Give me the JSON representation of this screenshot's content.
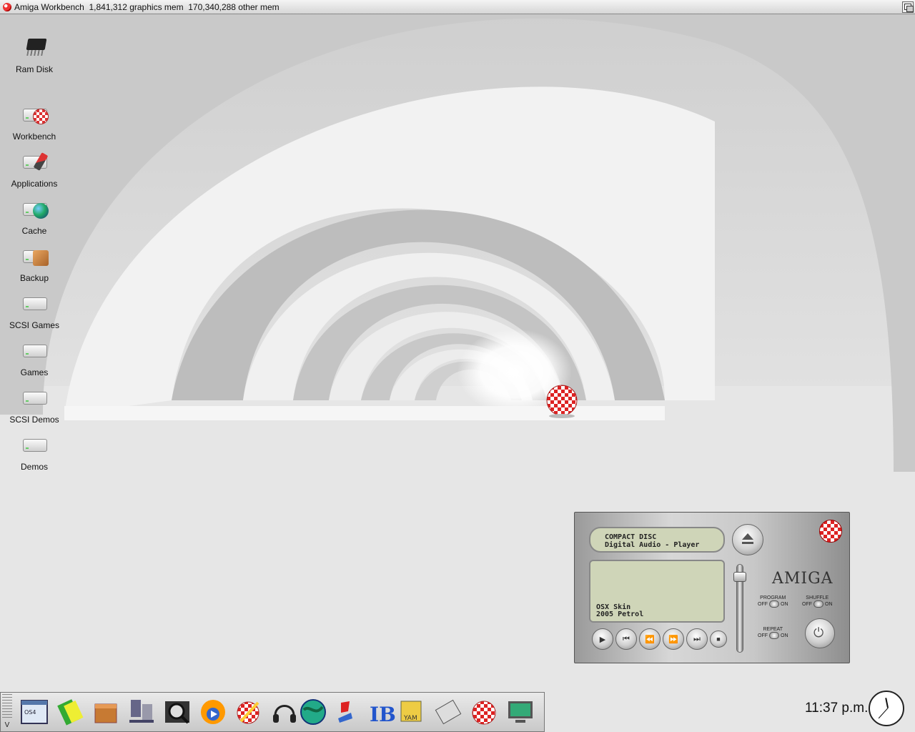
{
  "window": {
    "title": "Amiga Workbench  1,841,312 graphics mem  170,340,288 other mem"
  },
  "desktop": {
    "icons": [
      {
        "label": "Ram Disk",
        "icon": "ram-chip-icon"
      },
      {
        "label": "Workbench",
        "icon": "drive-boing-icon"
      },
      {
        "label": "Applications",
        "icon": "drive-tools-icon"
      },
      {
        "label": "Cache",
        "icon": "drive-globe-icon"
      },
      {
        "label": "Backup",
        "icon": "drive-box-icon"
      },
      {
        "label": "SCSI Games",
        "icon": "drive-icon"
      },
      {
        "label": "Games",
        "icon": "drive-icon"
      },
      {
        "label": "SCSI Demos",
        "icon": "drive-icon"
      },
      {
        "label": "Demos",
        "icon": "drive-icon"
      }
    ]
  },
  "cdplayer": {
    "lcd_top_line1": "COMPACT DISC",
    "lcd_top_line2": "Digital Audio - Player",
    "skin_line1": "OSX Skin",
    "skin_line2": "2005 Petrol",
    "brand": "AMIGA",
    "program": {
      "caption": "PROGRAM",
      "off": "OFF",
      "on": "ON"
    },
    "shuffle": {
      "caption": "SHUFFLE",
      "off": "OFF",
      "on": "ON"
    },
    "repeat": {
      "caption": "REPEAT",
      "off": "OFF",
      "on": "ON"
    },
    "volume_level": 0.9
  },
  "dock": {
    "items": [
      "os-info-icon",
      "notes-icon",
      "package-icon",
      "network-icon",
      "video-viewer-icon",
      "media-player-icon",
      "boing-paint-icon",
      "headphones-icon",
      "globe-icon",
      "flag-icon",
      "ib-browser-icon",
      "yam-mail-icon",
      "cdrom-tool-icon",
      "boing-ball-icon",
      "monitor-icon"
    ]
  },
  "clock": {
    "time": "11:37 p.m.",
    "hour": 11,
    "minute": 37
  }
}
